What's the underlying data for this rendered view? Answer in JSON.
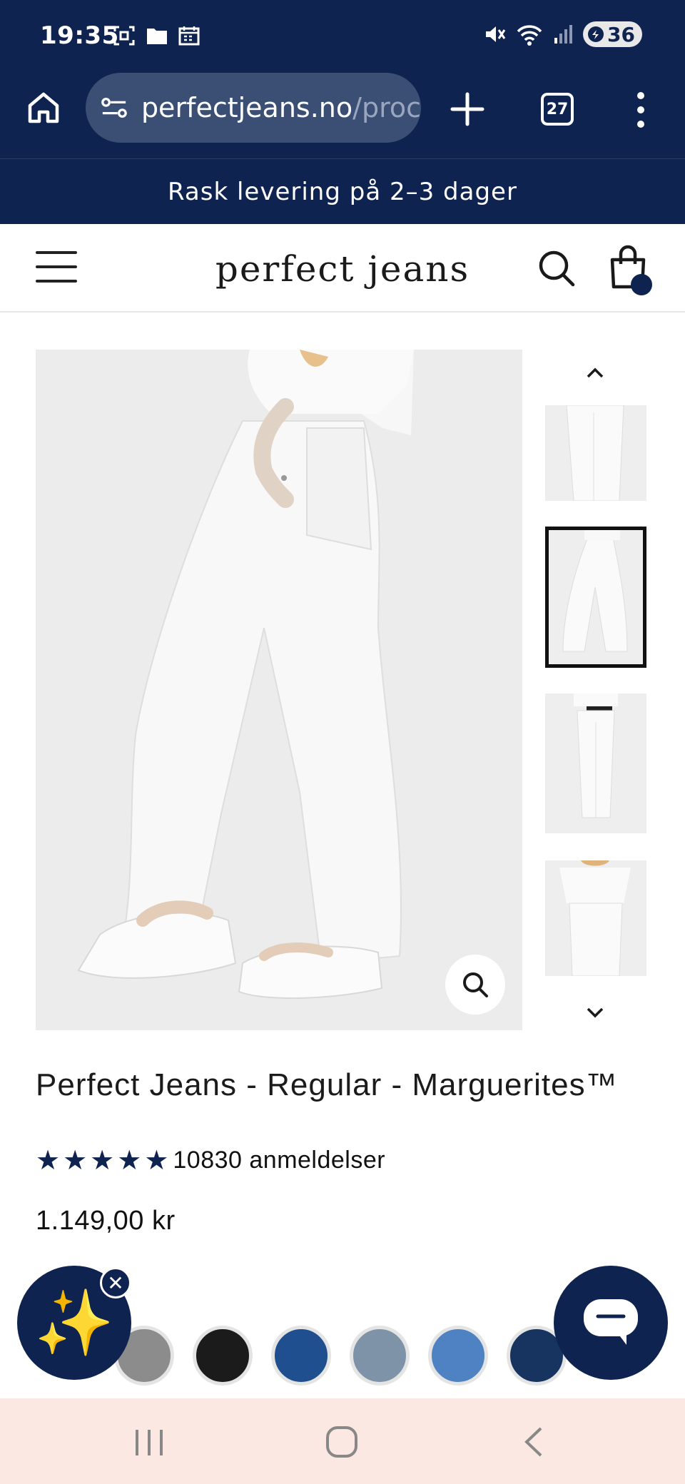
{
  "status_bar": {
    "time": "19:35",
    "battery": "36",
    "left_icons": [
      "screenshot-icon",
      "folder-icon",
      "calendar-icon"
    ],
    "right_icons": [
      "mute-icon",
      "wifi-icon",
      "signal-icon",
      "battery-icon"
    ]
  },
  "browser": {
    "url_main": "perfectjeans.no",
    "url_rest": "/proc",
    "tab_count": "27"
  },
  "announcement": "Rask levering på 2–3 dager",
  "header": {
    "logo": "perfect jeans"
  },
  "product": {
    "title": "Perfect Jeans - Regular - Marguerites™",
    "rating": 5,
    "review_count": "10830 anmeldelser",
    "price": "1.149,00 kr"
  },
  "swatches": [
    {
      "name": "grey",
      "color": "#8c8c8c"
    },
    {
      "name": "black",
      "color": "#1b1b1b"
    },
    {
      "name": "dark-blue",
      "color": "#1f4f8f"
    },
    {
      "name": "light-grey-blue",
      "color": "#7f93a8"
    },
    {
      "name": "mid-blue",
      "color": "#4e82c2"
    },
    {
      "name": "navy",
      "color": "#16345f"
    }
  ],
  "colors": {
    "brand_navy": "#0e2350",
    "nav_bar": "#fbe8e3"
  }
}
